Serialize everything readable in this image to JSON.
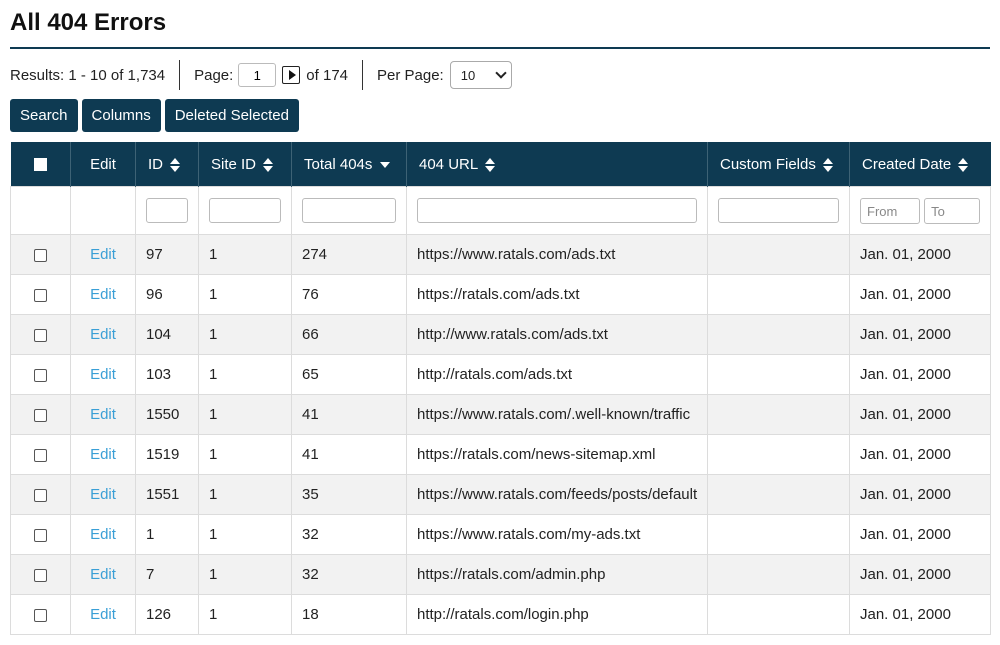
{
  "page": {
    "title": "All 404 Errors"
  },
  "pagination": {
    "results_text": "Results: 1 - 10 of 1,734",
    "page_label": "Page:",
    "page_value": "1",
    "of_text": "of 174",
    "per_page_label": "Per Page:",
    "per_page_value": "10"
  },
  "actions": {
    "search": "Search",
    "columns": "Columns",
    "delete_selected": "Deleted Selected"
  },
  "table": {
    "columns": {
      "edit": "Edit",
      "id": "ID",
      "site_id": "Site ID",
      "total": "Total 404s",
      "url": "404 URL",
      "custom": "Custom Fields",
      "created": "Created Date"
    },
    "filters": {
      "date_from_placeholder": "From",
      "date_to_placeholder": "To"
    },
    "edit_label": "Edit",
    "rows": [
      {
        "id": "97",
        "site_id": "1",
        "total": "274",
        "url": "https://www.ratals.com/ads.txt",
        "custom": "",
        "created": "Jan. 01, 2000"
      },
      {
        "id": "96",
        "site_id": "1",
        "total": "76",
        "url": "https://ratals.com/ads.txt",
        "custom": "",
        "created": "Jan. 01, 2000"
      },
      {
        "id": "104",
        "site_id": "1",
        "total": "66",
        "url": "http://www.ratals.com/ads.txt",
        "custom": "",
        "created": "Jan. 01, 2000"
      },
      {
        "id": "103",
        "site_id": "1",
        "total": "65",
        "url": "http://ratals.com/ads.txt",
        "custom": "",
        "created": "Jan. 01, 2000"
      },
      {
        "id": "1550",
        "site_id": "1",
        "total": "41",
        "url": "https://www.ratals.com/.well-known/traffic",
        "custom": "",
        "created": "Jan. 01, 2000"
      },
      {
        "id": "1519",
        "site_id": "1",
        "total": "41",
        "url": "https://ratals.com/news-sitemap.xml",
        "custom": "",
        "created": "Jan. 01, 2000"
      },
      {
        "id": "1551",
        "site_id": "1",
        "total": "35",
        "url": "https://www.ratals.com/feeds/posts/default",
        "custom": "",
        "created": "Jan. 01, 2000"
      },
      {
        "id": "1",
        "site_id": "1",
        "total": "32",
        "url": "https://www.ratals.com/my-ads.txt",
        "custom": "",
        "created": "Jan. 01, 2000"
      },
      {
        "id": "7",
        "site_id": "1",
        "total": "32",
        "url": "https://ratals.com/admin.php",
        "custom": "",
        "created": "Jan. 01, 2000"
      },
      {
        "id": "126",
        "site_id": "1",
        "total": "18",
        "url": "http://ratals.com/login.php",
        "custom": "",
        "created": "Jan. 01, 2000"
      }
    ]
  },
  "colors": {
    "header_bg": "#0e3a52",
    "link": "#3a9fd6",
    "row_alt": "#f2f2f2"
  },
  "icons": {
    "sort": "sort-both-icon",
    "sort_desc": "sort-desc-icon",
    "next_page": "next-page-icon",
    "dropdown": "chevron-down-icon"
  }
}
